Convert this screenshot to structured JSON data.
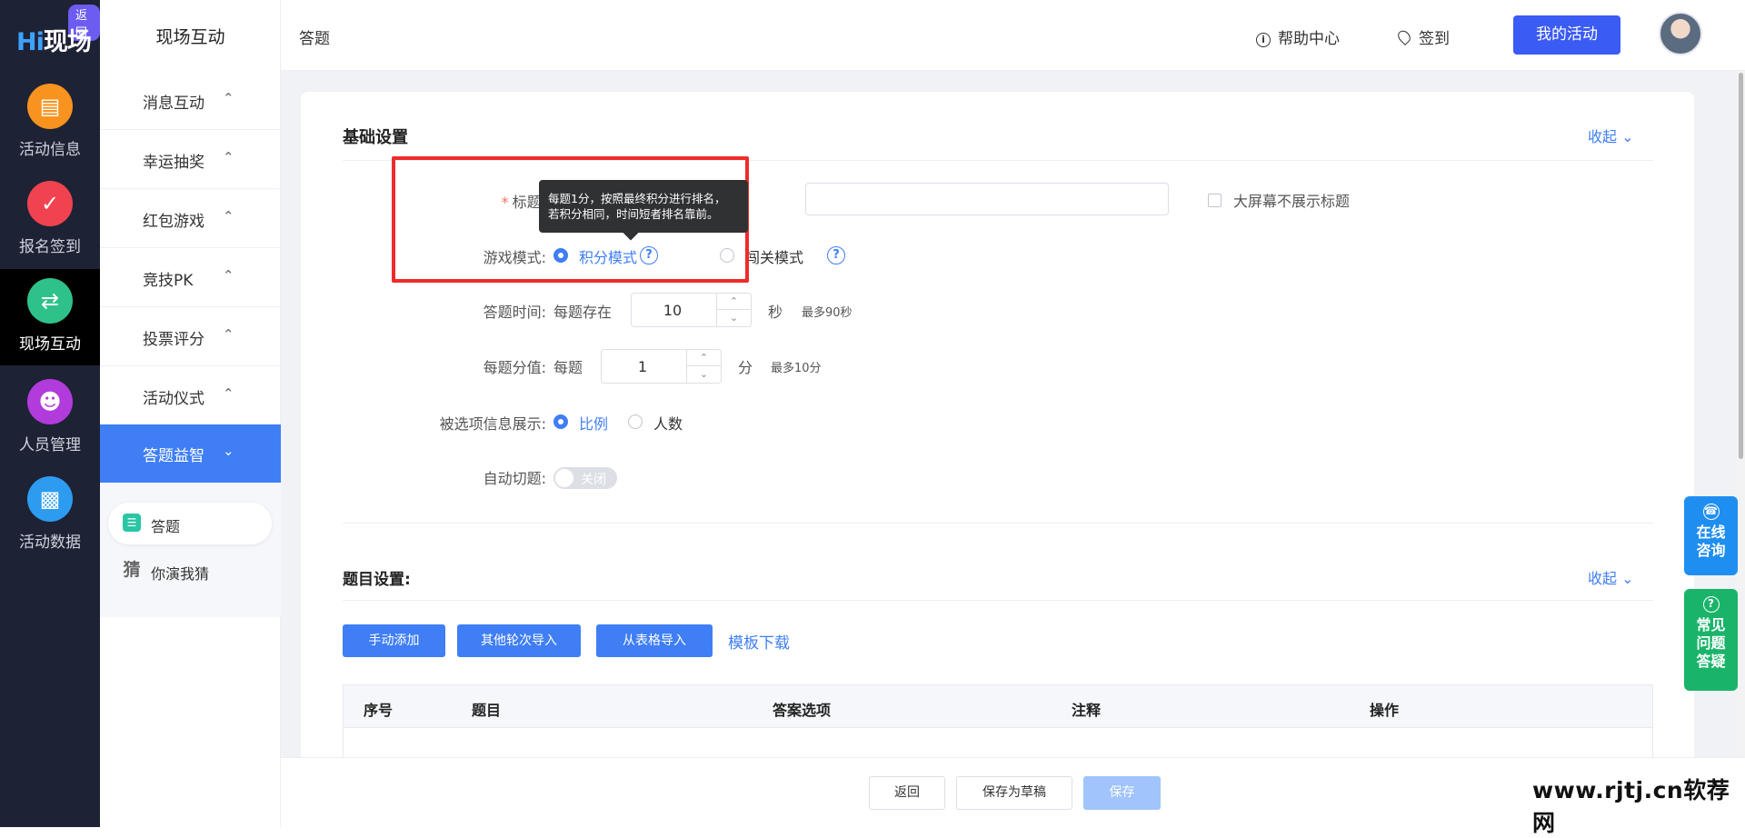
{
  "brand": {
    "logo_hi": "Hi",
    "logo_text": "现场",
    "back_badge": "返回"
  },
  "rail": [
    {
      "label": "活动信息",
      "icon": "document-icon",
      "color": "#f7931e"
    },
    {
      "label": "报名签到",
      "icon": "calendar-check-icon",
      "color": "#f0434f"
    },
    {
      "label": "现场互动",
      "icon": "interaction-icon",
      "color": "#2ec28a",
      "active": true
    },
    {
      "label": "人员管理",
      "icon": "person-badge-icon",
      "color": "#b23bdc"
    },
    {
      "label": "活动数据",
      "icon": "bar-chart-icon",
      "color": "#2d9cf0"
    }
  ],
  "sidebar": {
    "title": "现场互动",
    "items": [
      {
        "label": "消息互动",
        "chevron": "^"
      },
      {
        "label": "幸运抽奖",
        "chevron": "^"
      },
      {
        "label": "红包游戏",
        "chevron": "^"
      },
      {
        "label": "竞技PK",
        "chevron": "^"
      },
      {
        "label": "投票评分",
        "chevron": "^"
      },
      {
        "label": "活动仪式",
        "chevron": "^"
      },
      {
        "label": "答题益智",
        "chevron": "v",
        "active": true
      }
    ],
    "sub_items": [
      {
        "label": "答题",
        "icon": "chat-icon",
        "active": true
      },
      {
        "label": "你演我猜",
        "icon_text": "猜"
      }
    ]
  },
  "header": {
    "breadcrumb": "答题",
    "help": "帮助中心",
    "checkin": "签到",
    "my_activity": "我的活动"
  },
  "basic": {
    "title": "基础设置",
    "collapse": "收起",
    "title_label": "标题:",
    "title_required": "*",
    "title_value": "",
    "hide_title_label": "大屏幕不展示标题",
    "mode_label": "游戏模式:",
    "mode_score": "积分模式",
    "mode_level": "闯关模式",
    "tooltip_line1": "每题1分，按照最终积分进行排名，",
    "tooltip_line2": "若积分相同，时间短者排名靠前。",
    "time_label": "答题时间:",
    "time_prefix": "每题存在",
    "time_value": "10",
    "time_unit": "秒",
    "time_hint": "最多90秒",
    "score_label": "每题分值:",
    "score_prefix": "每题",
    "score_value": "1",
    "score_unit": "分",
    "score_hint": "最多10分",
    "display_label": "被选项信息展示:",
    "display_ratio": "比例",
    "display_count": "人数",
    "auto_label": "自动切题:",
    "auto_state": "关闭"
  },
  "questions": {
    "title": "题目设置:",
    "collapse": "收起",
    "btn_manual": "手动添加",
    "btn_other": "其他轮次导入",
    "btn_table": "从表格导入",
    "template": "模板下载",
    "columns": [
      "序号",
      "题目",
      "答案选项",
      "注释",
      "操作"
    ]
  },
  "footer": {
    "back": "返回",
    "draft": "保存为草稿",
    "save": "保存"
  },
  "floats": {
    "consult": [
      "在线",
      "咨询"
    ],
    "faq": [
      "常见",
      "问题",
      "答疑"
    ]
  },
  "watermark": "www.rjtj.cn软荐网",
  "colors": {
    "primary": "#3f7ef5",
    "rail_bg": "#1e2235",
    "highlight": "#ef2b2b",
    "float_blue": "#1f8ef1",
    "float_green": "#19b46a"
  }
}
